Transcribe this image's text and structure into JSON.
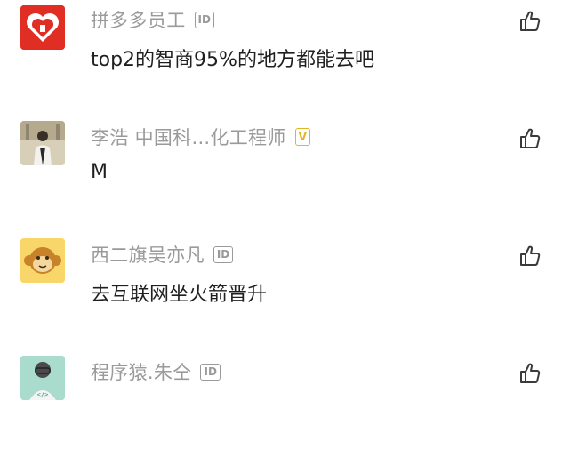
{
  "comments": [
    {
      "username": "拼多多员工",
      "badge": "ID",
      "badge_type": "id",
      "text": "top2的智商95%的地方都能去吧",
      "avatar_icon": "pinduoduo-logo",
      "avatar_color": "#e02e24"
    },
    {
      "username": "李浩 中国科...化工程师",
      "badge": "V",
      "badge_type": "verified",
      "text": "M",
      "avatar_icon": "person-photo",
      "avatar_color": "#c9bfa8"
    },
    {
      "username": "西二旗吴亦凡",
      "badge": "ID",
      "badge_type": "id",
      "text": "去互联网坐火箭晋升",
      "avatar_icon": "monkey-face",
      "avatar_color": "#f6c344"
    },
    {
      "username": "程序猿.朱仝",
      "badge": "ID",
      "badge_type": "id",
      "text": "",
      "avatar_icon": "programmer-avatar",
      "avatar_color": "#7ac9b4"
    }
  ],
  "colors": {
    "username": "#9a9a9a",
    "text": "#1f1f1f",
    "verified": "#e6b422",
    "icon": "#3a3a3a"
  },
  "like_icon": "thumbs-up-icon"
}
